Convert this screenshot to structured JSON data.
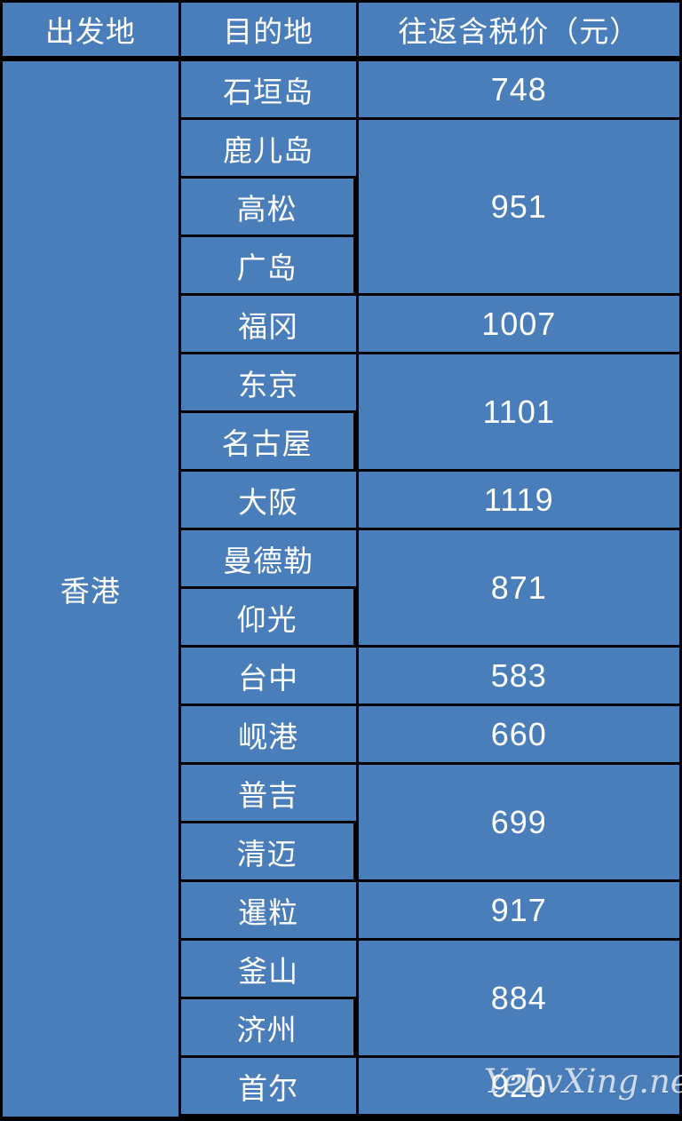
{
  "table": {
    "headers": {
      "origin": "出发地",
      "destination": "目的地",
      "price": "往返含税价（元）"
    },
    "origin": "香港",
    "groups": [
      {
        "destinations": [
          "石垣岛"
        ],
        "price": "748"
      },
      {
        "destinations": [
          "鹿儿岛",
          "高松",
          "广岛"
        ],
        "price": "951"
      },
      {
        "destinations": [
          "福冈"
        ],
        "price": "1007"
      },
      {
        "destinations": [
          "东京",
          "名古屋"
        ],
        "price": "1101"
      },
      {
        "destinations": [
          "大阪"
        ],
        "price": "1119"
      },
      {
        "destinations": [
          "曼德勒",
          "仰光"
        ],
        "price": "871"
      },
      {
        "destinations": [
          "台中"
        ],
        "price": "583"
      },
      {
        "destinations": [
          "岘港"
        ],
        "price": "660"
      },
      {
        "destinations": [
          "普吉",
          "清迈"
        ],
        "price": "699"
      },
      {
        "destinations": [
          "暹粒"
        ],
        "price": "917"
      },
      {
        "destinations": [
          "釜山",
          "济州"
        ],
        "price": "884"
      },
      {
        "destinations": [
          "首尔"
        ],
        "price": "920"
      }
    ]
  },
  "watermark": {
    "text": "YeLvXing.net"
  },
  "colors": {
    "cell_background": "#4a7ebb",
    "grid_line": "#000000",
    "text": "#ffffff"
  }
}
